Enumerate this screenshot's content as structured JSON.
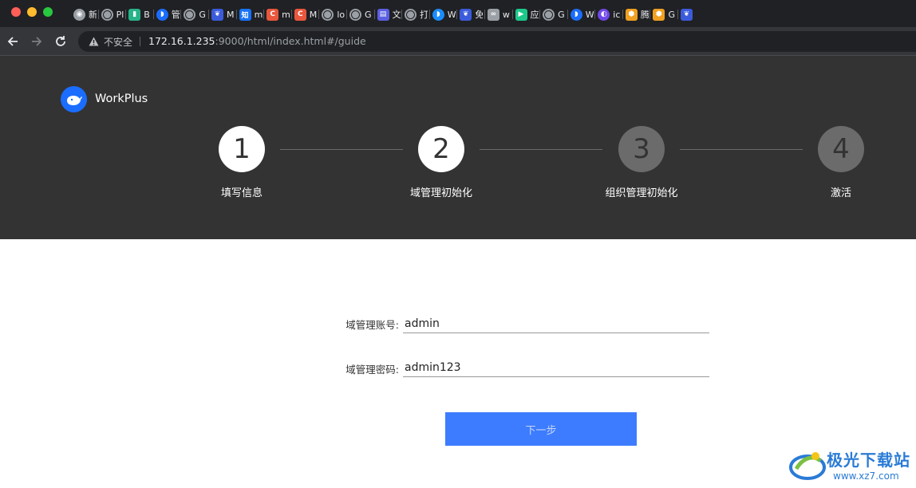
{
  "browser": {
    "tabs": [
      {
        "icon": "chrome-icon",
        "color": "#9aa0a6",
        "title": "新"
      },
      {
        "icon": "globe-icon",
        "color": "#9aa0a6",
        "title": "Pl"
      },
      {
        "icon": "bookmark-green-icon",
        "color": "#27b38a",
        "title": "B"
      },
      {
        "icon": "whale-icon",
        "color": "#1a6dff",
        "title": "管"
      },
      {
        "icon": "globe-icon",
        "color": "#9aa0a6",
        "title": "G"
      },
      {
        "icon": "baidu-paw-icon",
        "color": "#3b5bdb",
        "title": "M"
      },
      {
        "icon": "zhihu-icon",
        "color": "#1772f6",
        "title": "m"
      },
      {
        "icon": "csdn-icon",
        "color": "#e8573d",
        "title": "m"
      },
      {
        "icon": "csdn-icon",
        "color": "#e8573d",
        "title": "M"
      },
      {
        "icon": "globe-icon",
        "color": "#9aa0a6",
        "title": "lo"
      },
      {
        "icon": "globe-icon",
        "color": "#9aa0a6",
        "title": "G"
      },
      {
        "icon": "document-icon",
        "color": "#5b5fe0",
        "title": "文"
      },
      {
        "icon": "globe-icon",
        "color": "#9aa0a6",
        "title": "打"
      },
      {
        "icon": "whale-icon",
        "color": "#1a8cff",
        "title": "W"
      },
      {
        "icon": "baidu-paw-icon",
        "color": "#3b5bdb",
        "title": "免"
      },
      {
        "icon": "link-icon",
        "color": "#9aa0a6",
        "title": "w"
      },
      {
        "icon": "play-icon",
        "color": "#1cc88a",
        "title": "应"
      },
      {
        "icon": "globe-icon",
        "color": "#9aa0a6",
        "title": "G"
      },
      {
        "icon": "whale-icon",
        "color": "#1a6dff",
        "title": "W"
      },
      {
        "icon": "circle-logo-icon",
        "color": "#7048e8",
        "title": "ic"
      },
      {
        "icon": "hexagon-icon",
        "color": "#f0a020",
        "title": "腾"
      },
      {
        "icon": "hexagon-icon",
        "color": "#f0a020",
        "title": "G"
      },
      {
        "icon": "baidu-paw-icon",
        "color": "#3b5bdb",
        "title": ""
      }
    ],
    "address": {
      "insecure_label": "不安全",
      "host": "172.16.1.235",
      "rest": ":9000/html/index.html#/guide"
    }
  },
  "header": {
    "brand": "WorkPlus",
    "brand_color": "#1a6dff",
    "background": "#333333",
    "steps": [
      {
        "number": "1",
        "label": "填写信息",
        "state": "done"
      },
      {
        "number": "2",
        "label": "域管理初始化",
        "state": "done"
      },
      {
        "number": "3",
        "label": "组织管理初始化",
        "state": "todo"
      },
      {
        "number": "4",
        "label": "激活",
        "state": "todo"
      }
    ]
  },
  "form": {
    "account_label": "域管理账号:",
    "account_value": "admin",
    "password_label": "域管理密码:",
    "password_value": "admin123",
    "next_label": "下一步",
    "button_color": "#3d7cff"
  },
  "watermark": {
    "name": "极光下载站",
    "url": "www.xz7.com"
  }
}
